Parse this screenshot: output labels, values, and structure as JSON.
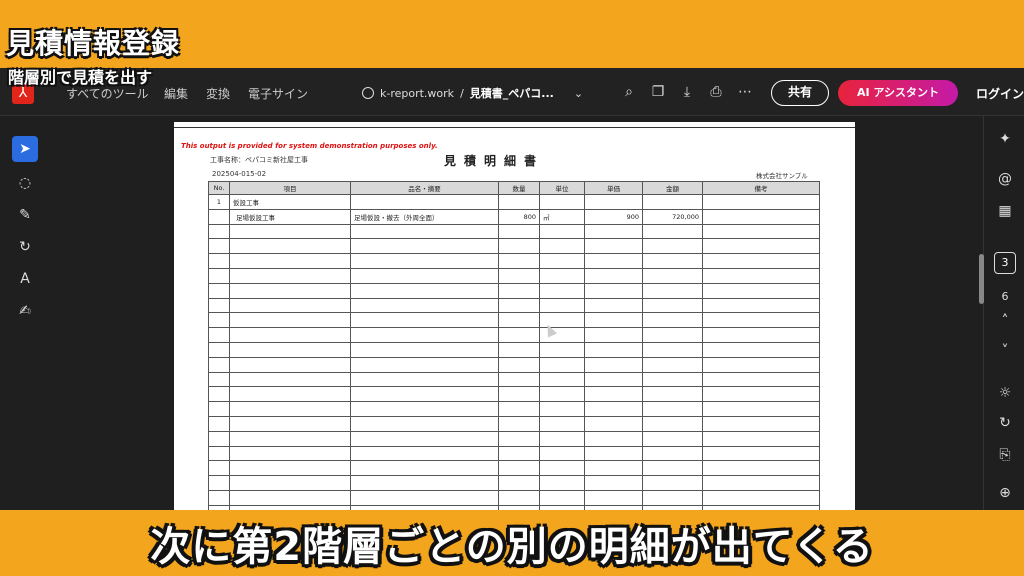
{
  "overlay": {
    "title": "見積情報登録",
    "subtitle": "階層別で見積を出す",
    "caption": "次に第2階層ごとの別の明細が出てくる"
  },
  "toolbar": {
    "menu": [
      "すべてのツール",
      "編集",
      "変換",
      "電子サイン"
    ],
    "site": "k-report.work",
    "separator": "/",
    "document": "見積書_ペパコ...",
    "share_label": "共有",
    "ai_label": "AI アシスタント",
    "login_label": "ログイン"
  },
  "viewer": {
    "current_page": "3",
    "total_pages": "6"
  },
  "document": {
    "demo_note": "This output is provided for system demonstration purposes only.",
    "title": "見積明細書",
    "project": "工事名称：ペパコミ新社屋工事",
    "doc_number": "202504-015-02",
    "company": "株式会社サンプル",
    "columns": [
      "No.",
      "項目",
      "品名・摘要",
      "数量",
      "単位",
      "単価",
      "金額",
      "備考"
    ],
    "rows": [
      [
        "1",
        "仮設工事",
        "",
        "",
        "",
        "",
        "",
        ""
      ],
      [
        "",
        "足場仮設工事",
        "足場仮設・撤去（外周全面）",
        "800",
        "㎡",
        "900",
        "720,000",
        ""
      ]
    ],
    "empty_rows": 20
  },
  "colors": {
    "frame": "#f3a51d",
    "app_bg": "#1f1f1f",
    "accent_blue": "#2b6de0",
    "ai_gradient_start": "#e8233c",
    "ai_gradient_end": "#c41aa8",
    "demo_note": "#dd1111"
  }
}
